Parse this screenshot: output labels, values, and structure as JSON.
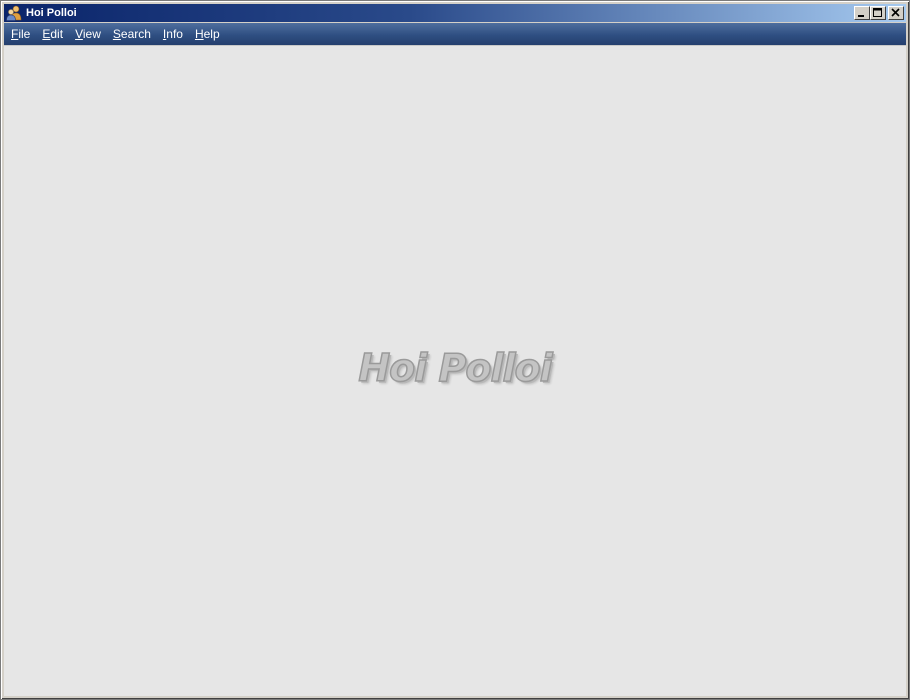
{
  "window": {
    "title": "Hoi Polloi",
    "title_bar_colors": [
      "#0a246a",
      "#a6caf0"
    ]
  },
  "title_buttons": {
    "minimize_icon": "minimize-icon",
    "maximize_icon": "maximize-icon",
    "close_icon": "close-icon"
  },
  "menubar": {
    "items": [
      {
        "mnemonic": "F",
        "rest": "ile"
      },
      {
        "mnemonic": "E",
        "rest": "dit"
      },
      {
        "mnemonic": "V",
        "rest": "iew"
      },
      {
        "mnemonic": "S",
        "rest": "earch"
      },
      {
        "mnemonic": "I",
        "rest": "nfo"
      },
      {
        "mnemonic": "H",
        "rest": "elp"
      }
    ],
    "background": "#2f4f82"
  },
  "content": {
    "watermark": "Hoi Polloi",
    "background": "#e6e6e6"
  }
}
